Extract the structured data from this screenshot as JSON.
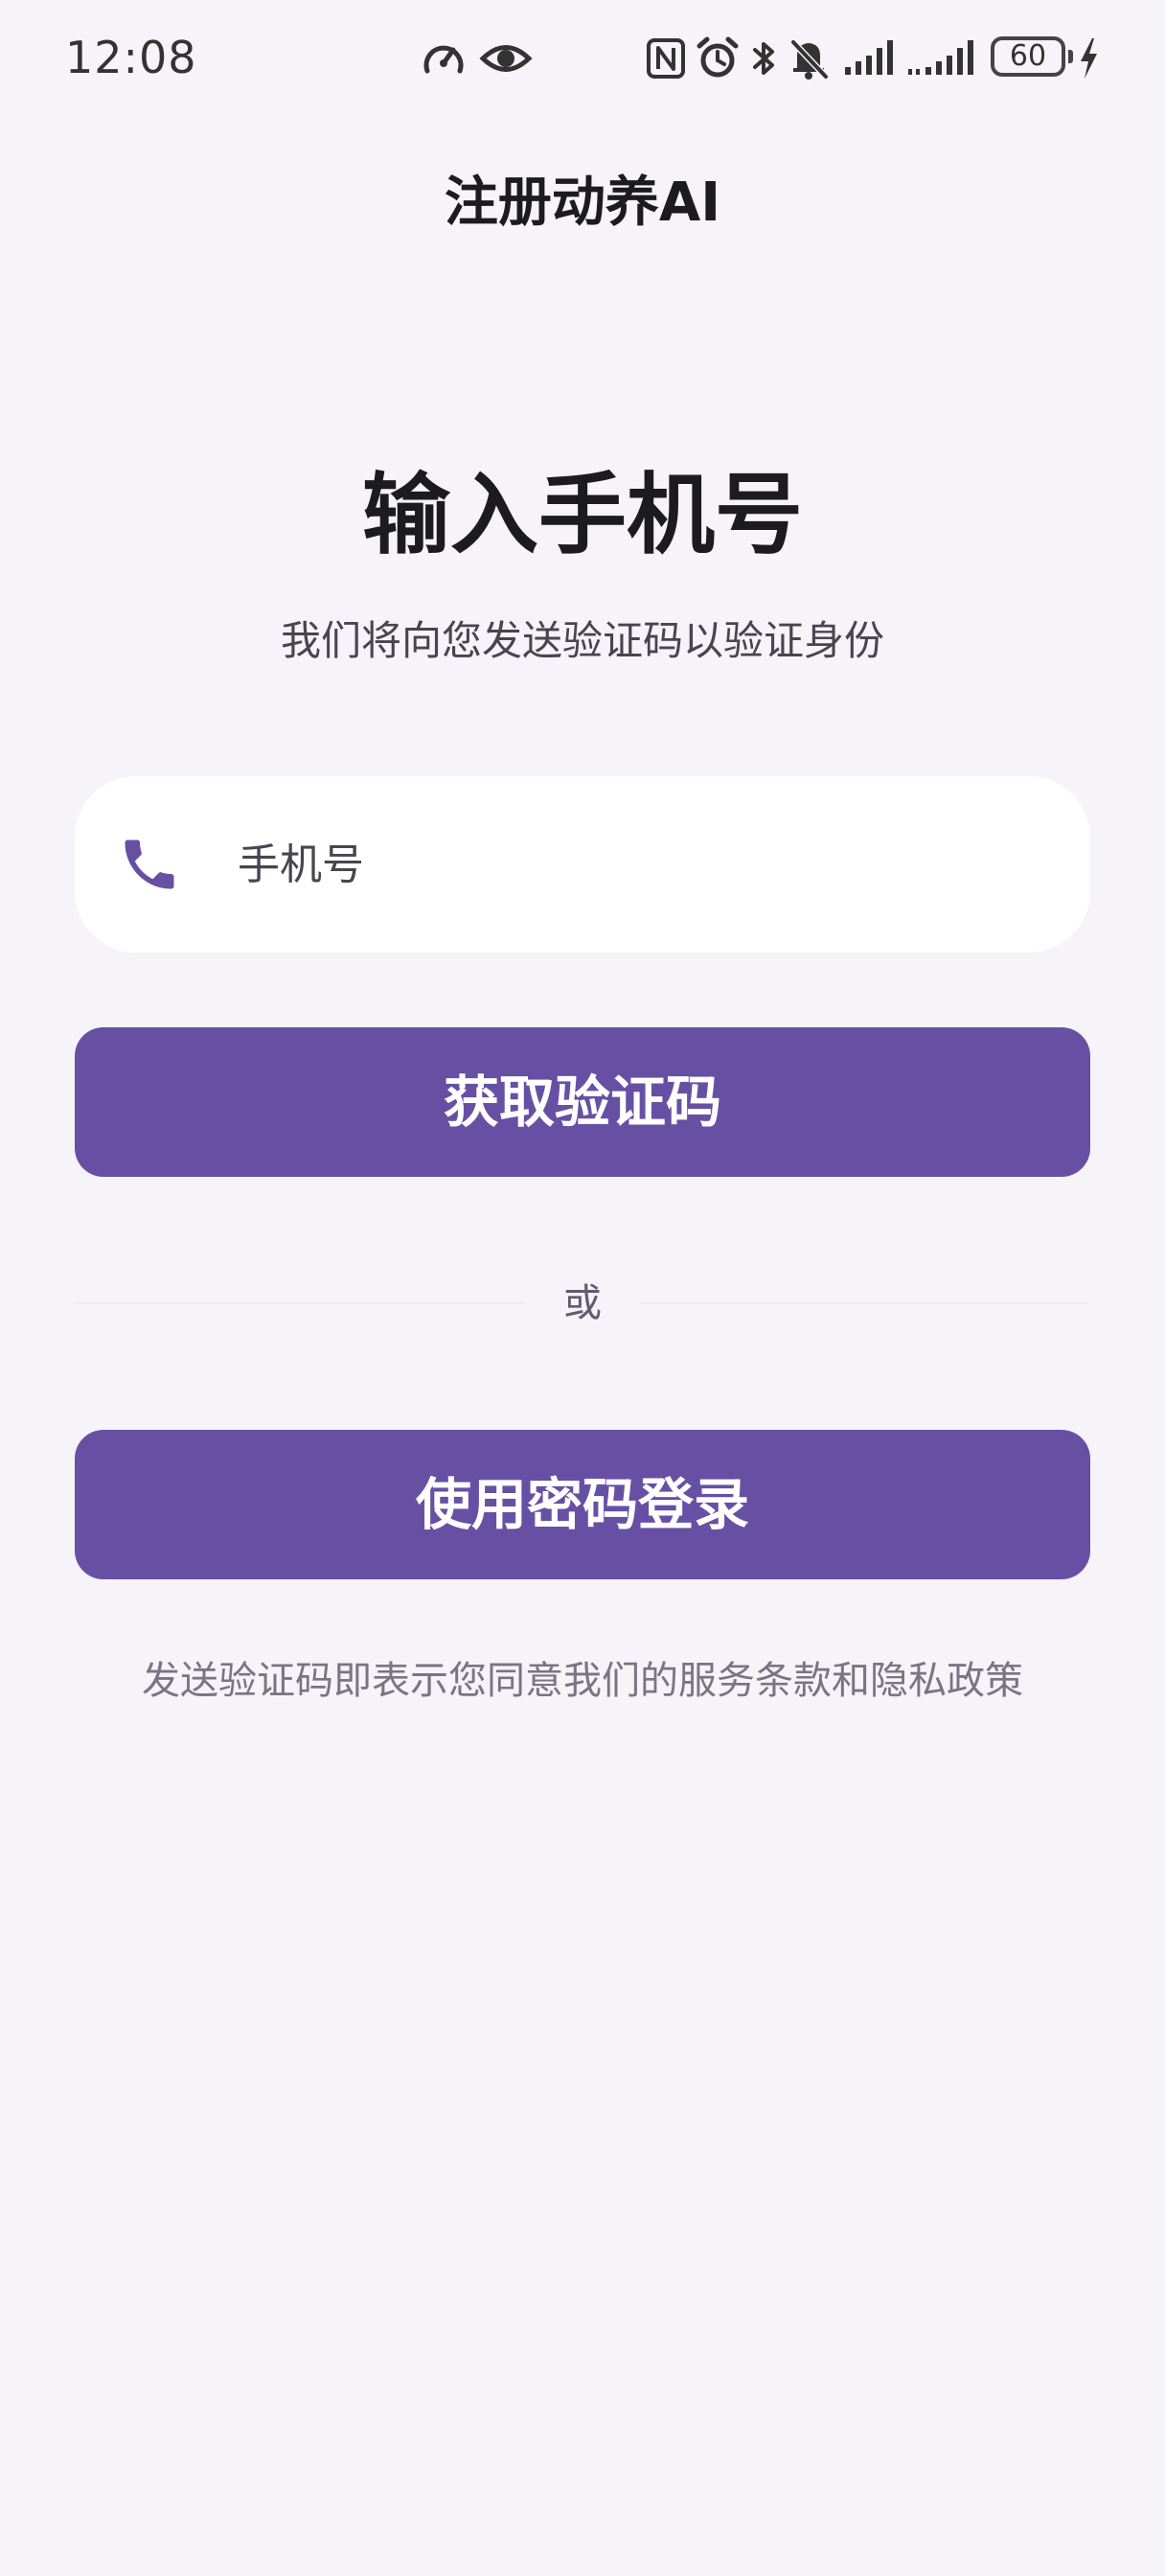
{
  "status_bar": {
    "time": "12:08",
    "battery_level": "60",
    "icons": [
      "speedometer-icon",
      "eye-icon",
      "nfc-icon",
      "alarm-icon",
      "bluetooth-icon",
      "bell-off-icon",
      "signal-icon",
      "signal-icon",
      "battery-icon",
      "charging-icon"
    ]
  },
  "app_bar": {
    "title": "注册动养AI"
  },
  "main": {
    "heading": "输入手机号",
    "subheading": "我们将向您发送验证码以验证身份",
    "phone_field": {
      "value": "",
      "placeholder": "手机号",
      "icon": "phone-icon"
    },
    "get_code_label": "获取验证码",
    "divider_label": "或",
    "password_login_label": "使用密码登录",
    "terms": "发送验证码即表示您同意我们的服务条款和隐私政策"
  },
  "colors": {
    "accent": "#6750a4",
    "background": "#f6f3f9",
    "surface": "#ffffff",
    "text_primary": "#1c1b1f",
    "text_secondary": "#49454f"
  }
}
